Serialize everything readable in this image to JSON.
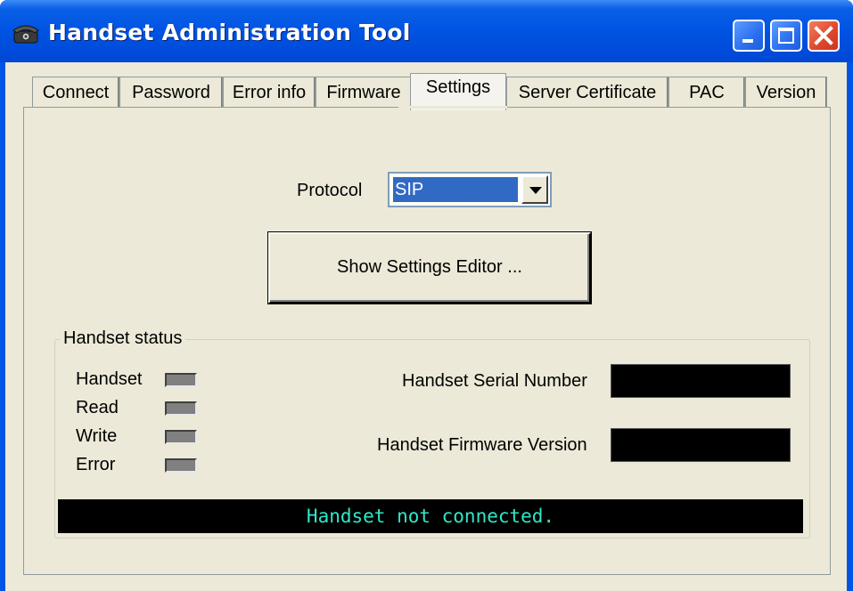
{
  "window": {
    "title": "Handset Administration Tool",
    "icon": "telephone-icon",
    "controls": [
      "minimize-icon",
      "maximize-icon",
      "close-icon"
    ]
  },
  "tabs": [
    {
      "label": "Connect"
    },
    {
      "label": "Password"
    },
    {
      "label": "Error info"
    },
    {
      "label": "Firmware"
    },
    {
      "label": "Settings",
      "active": true
    },
    {
      "label": "Server Certificate"
    },
    {
      "label": "PAC"
    },
    {
      "label": "Version"
    }
  ],
  "settings": {
    "protocol_label": "Protocol",
    "protocol_value": "SIP",
    "editor_button": "Show Settings Editor ..."
  },
  "status": {
    "group_title": "Handset status",
    "indicators": [
      {
        "label": "Handset"
      },
      {
        "label": "Read"
      },
      {
        "label": "Write"
      },
      {
        "label": "Error"
      }
    ],
    "serial_label": "Handset Serial Number",
    "serial_value": "",
    "firmware_label": "Handset Firmware Version",
    "firmware_value": "",
    "message": "Handset not connected.",
    "message_color": "#2ee8c8"
  },
  "colors": {
    "title_bar": "#0054e3",
    "face": "#ece9d8",
    "selection": "#316ac5",
    "close": "#e0492d"
  }
}
